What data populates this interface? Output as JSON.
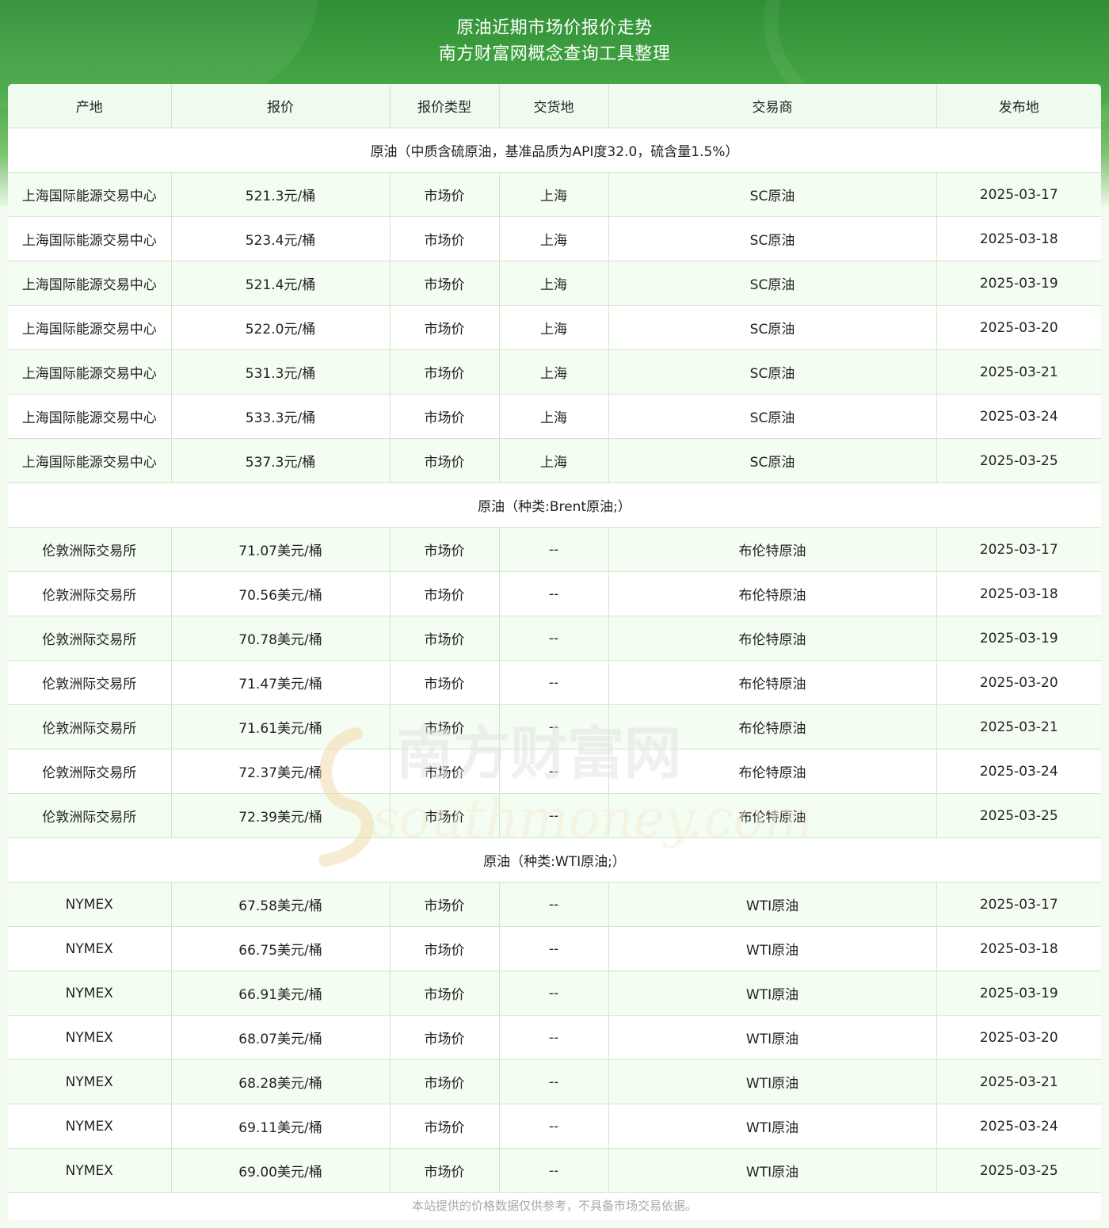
{
  "header": {
    "title_line1": "原油近期市场价报价走势",
    "title_line2": "南方财富网概念查询工具整理"
  },
  "table": {
    "columns": [
      "产地",
      "报价",
      "报价类型",
      "交货地",
      "交易商",
      "发布地"
    ],
    "groups": [
      {
        "title": "原油（中质含硫原油，基准品质为API度32.0，硫含量1.5%）",
        "rows": [
          [
            "上海国际能源交易中心",
            "521.3元/桶",
            "市场价",
            "上海",
            "SC原油",
            "2025-03-17"
          ],
          [
            "上海国际能源交易中心",
            "523.4元/桶",
            "市场价",
            "上海",
            "SC原油",
            "2025-03-18"
          ],
          [
            "上海国际能源交易中心",
            "521.4元/桶",
            "市场价",
            "上海",
            "SC原油",
            "2025-03-19"
          ],
          [
            "上海国际能源交易中心",
            "522.0元/桶",
            "市场价",
            "上海",
            "SC原油",
            "2025-03-20"
          ],
          [
            "上海国际能源交易中心",
            "531.3元/桶",
            "市场价",
            "上海",
            "SC原油",
            "2025-03-21"
          ],
          [
            "上海国际能源交易中心",
            "533.3元/桶",
            "市场价",
            "上海",
            "SC原油",
            "2025-03-24"
          ],
          [
            "上海国际能源交易中心",
            "537.3元/桶",
            "市场价",
            "上海",
            "SC原油",
            "2025-03-25"
          ]
        ]
      },
      {
        "title": "原油（种类:Brent原油;）",
        "rows": [
          [
            "伦敦洲际交易所",
            "71.07美元/桶",
            "市场价",
            "--",
            "布伦特原油",
            "2025-03-17"
          ],
          [
            "伦敦洲际交易所",
            "70.56美元/桶",
            "市场价",
            "--",
            "布伦特原油",
            "2025-03-18"
          ],
          [
            "伦敦洲际交易所",
            "70.78美元/桶",
            "市场价",
            "--",
            "布伦特原油",
            "2025-03-19"
          ],
          [
            "伦敦洲际交易所",
            "71.47美元/桶",
            "市场价",
            "--",
            "布伦特原油",
            "2025-03-20"
          ],
          [
            "伦敦洲际交易所",
            "71.61美元/桶",
            "市场价",
            "--",
            "布伦特原油",
            "2025-03-21"
          ],
          [
            "伦敦洲际交易所",
            "72.37美元/桶",
            "市场价",
            "--",
            "布伦特原油",
            "2025-03-24"
          ],
          [
            "伦敦洲际交易所",
            "72.39美元/桶",
            "市场价",
            "--",
            "布伦特原油",
            "2025-03-25"
          ]
        ]
      },
      {
        "title": "原油（种类:WTI原油;）",
        "rows": [
          [
            "NYMEX",
            "67.58美元/桶",
            "市场价",
            "--",
            "WTI原油",
            "2025-03-17"
          ],
          [
            "NYMEX",
            "66.75美元/桶",
            "市场价",
            "--",
            "WTI原油",
            "2025-03-18"
          ],
          [
            "NYMEX",
            "66.91美元/桶",
            "市场价",
            "--",
            "WTI原油",
            "2025-03-19"
          ],
          [
            "NYMEX",
            "68.07美元/桶",
            "市场价",
            "--",
            "WTI原油",
            "2025-03-20"
          ],
          [
            "NYMEX",
            "68.28美元/桶",
            "市场价",
            "--",
            "WTI原油",
            "2025-03-21"
          ],
          [
            "NYMEX",
            "69.11美元/桶",
            "市场价",
            "--",
            "WTI原油",
            "2025-03-24"
          ],
          [
            "NYMEX",
            "69.00美元/桶",
            "市场价",
            "--",
            "WTI原油",
            "2025-03-25"
          ]
        ]
      }
    ]
  },
  "footnote": "本站提供的价格数据仅供参考，不具备市场交易依据。",
  "watermark": {
    "text_cn": "南方财富网",
    "text_en": "southmoney.com"
  },
  "colors": {
    "header_green": "#47a845",
    "row_tint": "#f4fdf2",
    "border": "#d3e6cc"
  }
}
